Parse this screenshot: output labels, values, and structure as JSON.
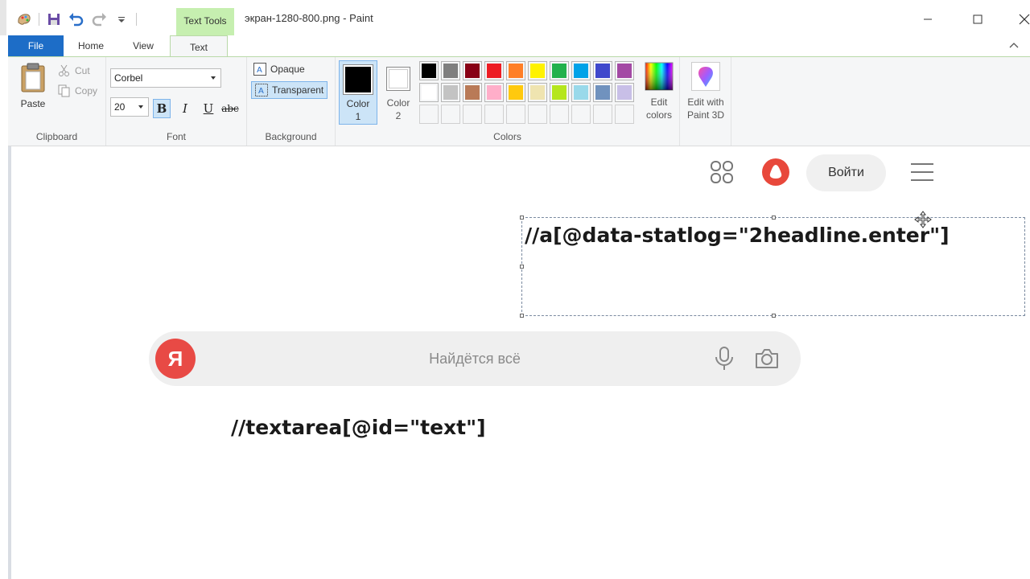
{
  "window": {
    "title": "экран-1280-800.png - Paint",
    "context_tab": "Text Tools"
  },
  "tabs": {
    "file": "File",
    "home": "Home",
    "view": "View",
    "text": "Text"
  },
  "clipboard": {
    "paste": "Paste",
    "cut": "Cut",
    "copy": "Copy",
    "group_label": "Clipboard"
  },
  "font": {
    "family": "Corbel",
    "size": "20",
    "bold": "B",
    "italic": "I",
    "underline": "U",
    "strikethrough": "abc",
    "group_label": "Font"
  },
  "background": {
    "opaque": "Opaque",
    "transparent": "Transparent",
    "group_label": "Background"
  },
  "colors": {
    "color1_line1": "Color",
    "color1_line2": "1",
    "color2_line1": "Color",
    "color2_line2": "2",
    "color1_value": "#000000",
    "color2_value": "#ffffff",
    "edit_line1": "Edit",
    "edit_line2": "colors",
    "group_label": "Colors",
    "palette_row1": [
      "#000000",
      "#7f7f7f",
      "#880015",
      "#ed1c24",
      "#ff7f27",
      "#fff200",
      "#22b14c",
      "#00a2e8",
      "#3f48cc",
      "#a349a4"
    ],
    "palette_row2": [
      "#ffffff",
      "#c3c3c3",
      "#b97a57",
      "#ffaec9",
      "#ffc90e",
      "#efe4b0",
      "#b5e61d",
      "#99d9ea",
      "#7092be",
      "#c8bfe7"
    ]
  },
  "paint3d": {
    "line1": "Edit with",
    "line2": "Paint 3D"
  },
  "canvas": {
    "login_button": "Войти",
    "search_placeholder": "Найдётся всё",
    "logo_letter": "Я",
    "xpath_top": "//a[@data-statlog=\"2headline.enter\"]",
    "xpath_bottom": "//textarea[@id=\"text\"]"
  }
}
